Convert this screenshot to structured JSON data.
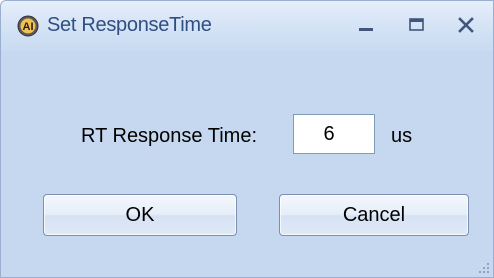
{
  "window": {
    "title": "Set ResponseTime",
    "icon": "app-logo-icon",
    "controls": {
      "minimize": "minimize-icon",
      "maximize": "maximize-icon",
      "close": "close-icon"
    }
  },
  "form": {
    "rt_label": "RT Response Time:",
    "rt_value": "6",
    "unit_label": "us"
  },
  "buttons": {
    "ok_label": "OK",
    "cancel_label": "Cancel"
  },
  "colors": {
    "title_text": "#2f4f82",
    "background": "#c6d8ef"
  }
}
